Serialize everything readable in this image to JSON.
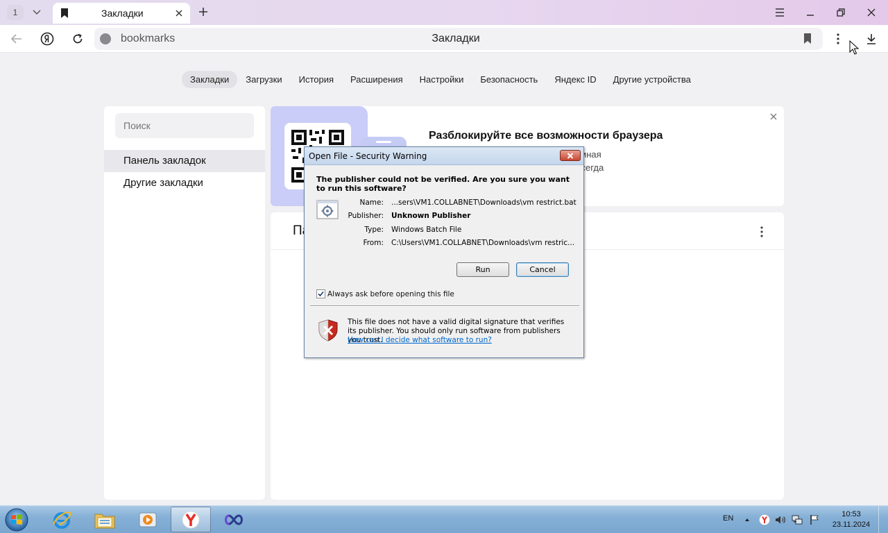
{
  "browser": {
    "tab_count": "1",
    "tab_title": "Закладки",
    "url": "bookmarks",
    "page_title": "Закладки"
  },
  "nav": {
    "tabs": [
      "Закладки",
      "Загрузки",
      "История",
      "Расширения",
      "Настройки",
      "Безопасность",
      "Яндекс ID",
      "Другие устройства"
    ],
    "active_index": 0
  },
  "sidebar": {
    "search_placeholder": "Поиск",
    "folders": [
      "Панель закладок",
      "Другие закладки"
    ]
  },
  "promo": {
    "title": "Разблокируйте все возможности браузера",
    "text_line1": "тором есть определитель номера, Умная",
    "text_line2": "закладки, пароли и другие данные всегда"
  },
  "main": {
    "header_title": "Па"
  },
  "dialog": {
    "title": "Open File - Security Warning",
    "question": "The publisher could not be verified.  Are you sure you want to run this software?",
    "name_label": "Name:",
    "name_value": "...sers\\VM1.COLLABNET\\Downloads\\vm restrict.bat",
    "publisher_label": "Publisher:",
    "publisher_value": "Unknown Publisher",
    "type_label": "Type:",
    "type_value": "Windows Batch File",
    "from_label": "From:",
    "from_value": "C:\\Users\\VM1.COLLABNET\\Downloads\\vm restric...",
    "run_label": "Run",
    "cancel_label": "Cancel",
    "checkbox_label": "Always ask before opening this file",
    "checkbox_checked": true,
    "warning_text": "This file does not have a valid digital signature that verifies its publisher.  You should only run software from publishers you trust.",
    "help_link": "How can I decide what software to run?"
  },
  "taskbar": {
    "language": "EN",
    "time": "10:53",
    "date": "23.11.2024",
    "apps": [
      "internet-explorer",
      "file-explorer",
      "media-player",
      "yandex-browser",
      "infinity-app"
    ]
  }
}
